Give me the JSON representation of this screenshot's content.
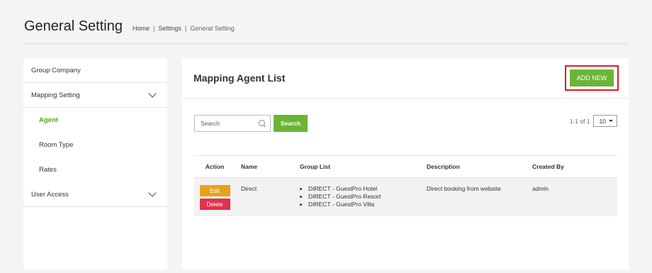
{
  "page": {
    "title": "General Setting",
    "breadcrumb": [
      {
        "label": "Home"
      },
      {
        "label": "Settings"
      },
      {
        "label": "General Setting"
      }
    ]
  },
  "sidebar": {
    "items": [
      {
        "label": "Group Company"
      },
      {
        "label": "Mapping Setting"
      },
      {
        "label": "Agent"
      },
      {
        "label": "Room Type"
      },
      {
        "label": "Rates"
      },
      {
        "label": "User Access"
      }
    ],
    "accent_color": "#6bb536"
  },
  "main": {
    "title": "Mapping Agent List",
    "add_button": "ADD NEW",
    "search": {
      "placeholder": "Search",
      "button": "Search"
    },
    "pager": {
      "info": "1-1 of 1",
      "page_size": "10"
    },
    "table": {
      "headers": [
        "Action",
        "Name",
        "Group List",
        "Description",
        "Created By"
      ],
      "rows": [
        {
          "edit_label": "Edit",
          "delete_label": "Delete",
          "name": "Direct",
          "group_list": [
            "DIRECT - GuestPro Hotel",
            "DIRECT - GuestPro Resort",
            "DIRECT - GuestPro Villa"
          ],
          "description": "Direct booking from website",
          "created_by": "admin"
        }
      ]
    }
  },
  "colors": {
    "primary_green": "#6bb536",
    "edit_orange": "#e6a31a",
    "delete_red": "#e0324a",
    "highlight_red": "#e01b24"
  }
}
